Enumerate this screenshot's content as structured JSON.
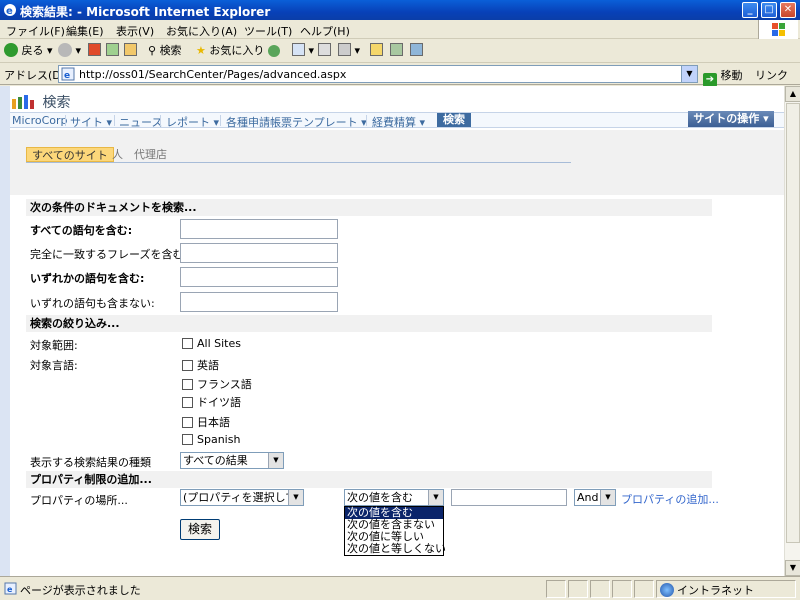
{
  "window": {
    "title": "検索結果: - Microsoft Internet Explorer",
    "minimize": "_",
    "maximize": "□",
    "close": "✕"
  },
  "menu": [
    "ファイル(F)",
    "編集(E)",
    "表示(V)",
    "お気に入り(A)",
    "ツール(T)",
    "ヘルプ(H)"
  ],
  "toolbar": {
    "back": "戻る",
    "search": "検索",
    "favorites": "お気に入り"
  },
  "address": {
    "label": "アドレス(D)",
    "url": "http://oss01/SearchCenter/Pages/advanced.aspx",
    "go": "移動",
    "links": "リンク"
  },
  "site": {
    "title": "検索",
    "nav": [
      {
        "label": "MicroCorp"
      },
      {
        "label": "サイト ▾"
      },
      {
        "label": "ニュース"
      },
      {
        "label": "レポート ▾"
      },
      {
        "label": "各種申請帳票テンプレート ▾"
      },
      {
        "label": "経費精算 ▾"
      },
      {
        "label": "検索"
      }
    ],
    "site_actions": "サイトの操作 ▾"
  },
  "scopes": [
    "すべてのサイト",
    "人",
    "代理店"
  ],
  "find": {
    "header": "次の条件のドキュメントを検索...",
    "all_words": "すべての語句を含む:",
    "exact_phrase": "完全に一致するフレーズを含む:",
    "any_words": "いずれかの語句を含む:",
    "none_words": "いずれの語句も含まない:"
  },
  "narrow": {
    "header": "検索の絞り込み...",
    "scope_label": "対象範囲:",
    "scope_option": "All Sites",
    "language_label": "対象言語:",
    "languages": [
      "英語",
      "フランス語",
      "ドイツ語",
      "日本語",
      "Spanish"
    ],
    "result_type_label": "表示する検索結果の種類",
    "result_type_value": "すべての結果"
  },
  "property": {
    "header": "プロパティ制限の追加...",
    "where_label": "プロパティの場所...",
    "property_select": "(プロパティを選択してく",
    "operator_select": "次の値を含む",
    "operator_options": [
      "次の値を含む",
      "次の値を含まない",
      "次の値に等しい",
      "次の値と等しくない"
    ],
    "andor_select": "And",
    "add_link": "プロパティの追加..."
  },
  "search_button": "検索",
  "status": {
    "text": "ページが表示されました",
    "zone": "イントラネット"
  }
}
